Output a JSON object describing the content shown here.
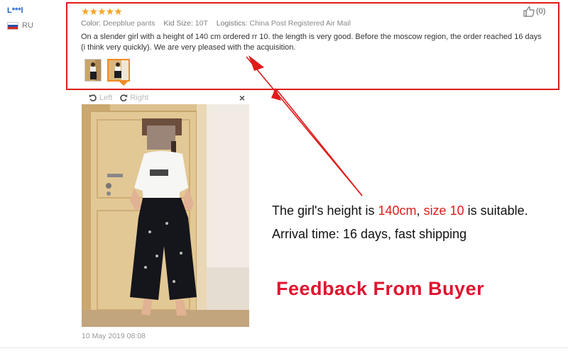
{
  "user": {
    "name": "L***l",
    "country": "RU"
  },
  "review": {
    "stars": "★★★★★",
    "rating": 5,
    "color_label": "Color:",
    "color_value": "Deepblue pants",
    "size_label": "Kid Size:",
    "size_value": "10T",
    "logistics_label": "Logistics:",
    "logistics_value": "China Post Registered Air Mail",
    "text": "On a slender girl with a height of 140 cm ordered rr 10. the length is very good. Before the moscow region, the order reached 16 days (i think very quickly). We are very pleased with the acquisition.",
    "helpful_count": "(0)",
    "date": "10 May 2019 08:08"
  },
  "viewer": {
    "rotate_left_label": "Left",
    "rotate_right_label": "Right",
    "close_label": "×"
  },
  "annotation": {
    "line1_part1": "The girl's height is ",
    "line1_height": "140cm",
    "line1_part2": ", ",
    "line1_size": "size 10",
    "line1_part3": " is suitable.",
    "line2": "Arrival time: 16 days, fast shipping",
    "headline": "Feedback From Buyer"
  },
  "colors": {
    "highlight": "#e01b1b",
    "star": "#f5a623",
    "headline": "#e0142e",
    "link": "#1f5fbf",
    "selected_thumb": "#f08a24"
  }
}
